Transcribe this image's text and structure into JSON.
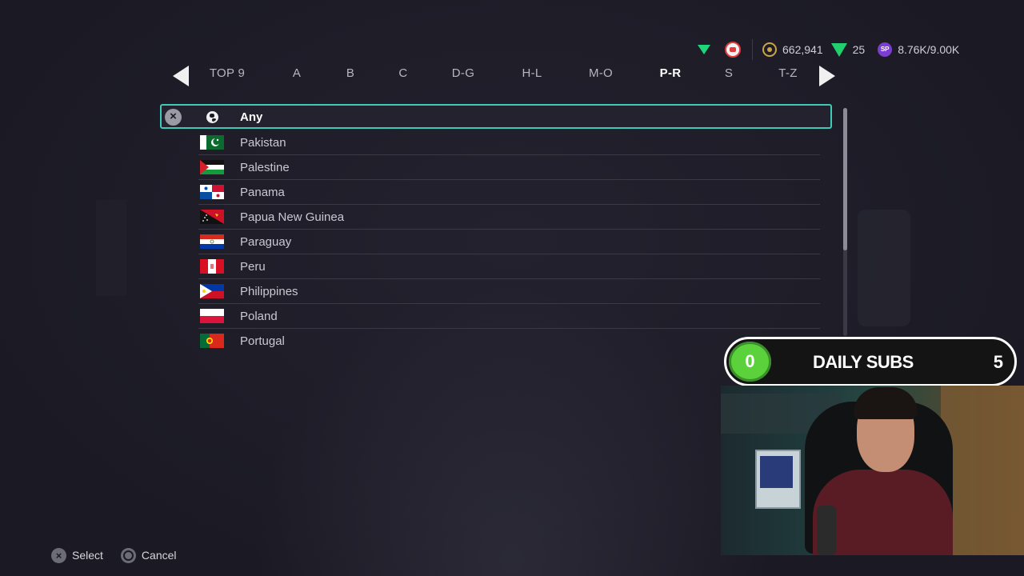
{
  "currency": {
    "coins": "662,941",
    "points": "25",
    "sp": "8.76K/9.00K",
    "sp_icon_label": "SP",
    "icons": [
      "green-triangle-icon",
      "club-badge-icon",
      "coin-icon",
      "gem-icon",
      "sp-icon"
    ]
  },
  "tabs": [
    "TOP 9",
    "A",
    "B",
    "C",
    "D-G",
    "H-L",
    "M-O",
    "P-R",
    "S",
    "T-Z"
  ],
  "active_tab": "P-R",
  "nations": {
    "any_label": "Any",
    "items": [
      "Pakistan",
      "Palestine",
      "Panama",
      "Papua New Guinea",
      "Paraguay",
      "Peru",
      "Philippines",
      "Poland",
      "Portugal"
    ]
  },
  "footer": {
    "select_label": "Select",
    "cancel_label": "Cancel"
  },
  "overlay": {
    "title": "DAILY SUBS",
    "current": "0",
    "goal": "5",
    "accent": "#5bd13b"
  },
  "colors": {
    "background": "#1b1a24",
    "focus_outline": "#3ec9b9"
  }
}
